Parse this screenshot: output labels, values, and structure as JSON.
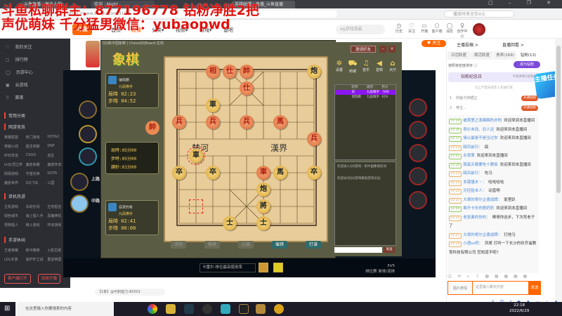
{
  "overlay": {
    "line1": "斗鱼私聊群主：877196778  钻粉净胜2把",
    "line2": "声优萌妹 千分猛男微信：yubaopwd"
  },
  "browser": {
    "tabs": [
      "斗鱼直播 - 每个人的直播平台",
      "欢迎 · Night",
      "英雄联盟 - 直播_斗鱼直播"
    ],
    "url": "https://www.douyu.com/317",
    "search_placeholder": "播放时来全仅4元",
    "window_controls": "□ – ❐ ✕"
  },
  "site": {
    "logo": "斗鱼",
    "nav": [
      "首页",
      "直播",
      "分类▾",
      "视频▾",
      "游戏▾",
      "鱼吧"
    ],
    "search_placeholder": "ag游戏我最",
    "header_icons": [
      {
        "icon": "history-icon",
        "label": "历史",
        "glyph": "◷"
      },
      {
        "icon": "heart-icon",
        "label": "关注",
        "glyph": "♡"
      },
      {
        "icon": "broadcast-icon",
        "label": "开播",
        "glyph": "▭"
      },
      {
        "icon": "client-icon",
        "label": "客户端",
        "glyph": "⬡"
      },
      {
        "icon": "message-icon",
        "label": "消息",
        "glyph": "◯"
      },
      {
        "icon": "creator-icon",
        "label": "创作中心",
        "glyph": "♀"
      }
    ],
    "follow": "♥ 关注"
  },
  "sidebar": {
    "items": [
      {
        "icon": "♡",
        "label": "我的关注"
      },
      {
        "icon": "▢",
        "label": "排行榜"
      },
      {
        "icon": "◯",
        "label": "页游中心"
      },
      {
        "icon": "▣",
        "label": "云游戏"
      },
      {
        "icon": "♖",
        "label": "赛事"
      }
    ],
    "sections": [
      {
        "title": "常用分类",
        "items": []
      },
      {
        "title": "网游竞技",
        "items": [
          "英雄联盟",
          "热门游戏",
          "DOTA2",
          "穿越火线",
          "超击突破",
          "DNF",
          "炉石传说",
          "CSGO",
          "逃生",
          "lol云顶之弈",
          "魔兽争霸",
          "魔兽怀旧",
          "网易游戏",
          "守望先锋",
          "DOTA",
          "魔兽世界",
          "QQ飞车",
          "三国"
        ]
      },
      {
        "title": "单机热游",
        "items": [
          "主机游戏",
          "永劫无间",
          "生死狙击",
          "绿色城市",
          "海上猎人手",
          "恶魔神机",
          "怪物猎人",
          "格斗游戏",
          "怀旧游戏"
        ]
      },
      {
        "title": "手游休闲",
        "items": [
          "王者荣耀",
          "和平精英",
          "火影忍者",
          "LOL手游",
          "金铲铲之战",
          "重返帝国"
        ]
      }
    ],
    "buttons": [
      "客户端打开",
      "回放开播"
    ]
  },
  "lol": {
    "lanes": [
      "上路",
      "中路"
    ],
    "champ_select": "卡雷尔-排位最高使用率",
    "mode_top": "5V5",
    "mode": "排位赛 单排/双排"
  },
  "chess": {
    "title": "QQ新中国象棋 | ChessQQBoard 在线",
    "logo": "象棋",
    "player_top": {
      "name": "瑞狗鹏",
      "rank": "九段棋手",
      "game_time_label": "局時",
      "game_time": "02:23",
      "step_time_label": "步時",
      "step_time": "04:52"
    },
    "settings": [
      {
        "label": "局時:",
        "value": "05分00"
      },
      {
        "label": "步時:",
        "value": "05分00"
      },
      {
        "label": "讀秒:",
        "value": "01分00"
      }
    ],
    "player_bottom": {
      "name": "自家的象",
      "rank": "九段棋手",
      "game_time_label": "局時",
      "game_time": "02:41",
      "step_time_label": "步時",
      "step_time": "00:00"
    },
    "river_left": "楚河",
    "river_right": "漢界",
    "captured": "帥",
    "pieces": [
      {
        "c": "相",
        "side": "red",
        "col": 2,
        "row": 0
      },
      {
        "c": "仕",
        "side": "red",
        "col": 3,
        "row": 0
      },
      {
        "c": "帥",
        "side": "red",
        "col": 4,
        "row": 0
      },
      {
        "c": "仕",
        "side": "red",
        "col": 4,
        "row": 1
      },
      {
        "c": "兵",
        "side": "red",
        "col": 0,
        "row": 3
      },
      {
        "c": "兵",
        "side": "red",
        "col": 2,
        "row": 3
      },
      {
        "c": "兵",
        "side": "red",
        "col": 4,
        "row": 3
      },
      {
        "c": "馬",
        "side": "red",
        "col": 6,
        "row": 3
      },
      {
        "c": "兵",
        "side": "red",
        "col": 8,
        "row": 4
      },
      {
        "c": "車",
        "side": "red",
        "col": 5,
        "row": 6
      },
      {
        "c": "炮",
        "side": "black",
        "col": 8,
        "row": 0
      },
      {
        "c": "車",
        "side": "black",
        "col": 2,
        "row": 2
      },
      {
        "c": "車",
        "side": "black",
        "col": 1,
        "row": 5,
        "selected": true
      },
      {
        "c": "卒",
        "side": "black",
        "col": 0,
        "row": 6
      },
      {
        "c": "卒",
        "side": "black",
        "col": 2,
        "row": 6
      },
      {
        "c": "馬",
        "side": "black",
        "col": 6,
        "row": 6
      },
      {
        "c": "卒",
        "side": "black",
        "col": 8,
        "row": 6
      },
      {
        "c": "炮",
        "side": "black",
        "col": 5,
        "row": 7
      },
      {
        "c": "將",
        "side": "black",
        "col": 5,
        "row": 8
      },
      {
        "c": "士",
        "side": "black",
        "col": 3,
        "row": 9
      },
      {
        "c": "士",
        "side": "black",
        "col": 5,
        "row": 9
      }
    ],
    "last_move_from": {
      "col": 1,
      "row": 8
    },
    "buttons": [
      {
        "label": "求和",
        "enabled": false
      },
      {
        "label": "悔棋",
        "enabled": false
      },
      {
        "label": "认输",
        "enabled": false
      },
      {
        "label": "催棋",
        "enabled": true
      },
      {
        "label": "打谱",
        "enabled": true
      }
    ],
    "invite": "邀请好友",
    "tools": [
      {
        "icon": "gear-icon",
        "glyph": "✲",
        "label": "设置"
      },
      {
        "icon": "cart-icon",
        "glyph": "⛟",
        "label": "商城"
      },
      {
        "icon": "music-icon",
        "glyph": "♫",
        "label": "音乐"
      },
      {
        "icon": "speaker-icon",
        "glyph": "◀",
        "label": "音效"
      },
      {
        "icon": "home-icon",
        "glyph": "⌂",
        "label": "大厅"
      }
    ],
    "table_headers": [
      "昵称",
      "级别",
      "积分"
    ],
    "table_rows": [
      {
        "name": "白",
        "rank": "九段棋手",
        "score": "-500",
        "selected": true
      },
      {
        "name": "瑞狗鹏",
        "rank": "九段棋手",
        "score": "619"
      }
    ],
    "messages": [
      "欢迎进入QQ游戏 - 新中国象棋房间",
      "欢迎访问QQ游戏棋类游戏论坛:"
    ],
    "send": "发送"
  },
  "stream": {
    "notice": "【1条】@可积能力-8X501"
  },
  "right": {
    "host_posts": "主播投稿 >",
    "replay": "直播回看 >",
    "tabs": [
      "日活跃度",
      "周活跃度",
      "贵宾(169)",
      "钻粉(13)"
    ],
    "sort_label": "按照亲密度排序 ⓘ",
    "become_fan": "成为钻粉",
    "memorial": "钻粉纪念日",
    "memorial_note": "今日共有1位钻粉",
    "memorial_sub": "马上严禁未成年人充值打赏",
    "ranks": [
      {
        "n": "1",
        "name": "阿鱼与你晒辽"
      },
      {
        "n": "2",
        "name": "咻五..."
      }
    ],
    "rank_badge": "开通钻粉",
    "task_badge": "主播任务",
    "chat": [
      {
        "lv": "LV 39",
        "user": "被窝里之清离瞬的亦昀",
        "text": "欢迎来到本直播间"
      },
      {
        "lv": "LV 36",
        "user": "青衫未改、旧人还",
        "text": "欢迎来到本直播间"
      },
      {
        "lv": "LV 37",
        "user": "倘以最是不是当过你",
        "text": "欢迎来到本直播间"
      },
      {
        "lv": "LV 13",
        "user": "瓯风前行：",
        "text": "搞",
        "low": true
      },
      {
        "lv": "LV 41",
        "user": "永夜翠",
        "text": "欢迎来到本直播间"
      },
      {
        "lv": "LV 39",
        "user": "我每天都要吃十颗饭",
        "text": "欢迎来到本直播间"
      },
      {
        "lv": "LV 13",
        "user": "瓯风前行：",
        "text": "吃马",
        "low": true
      },
      {
        "lv": "LV 15",
        "user": "多需懂木丶：",
        "text": "哈哈哈哈",
        "low": true
      },
      {
        "lv": "LV 13",
        "user": "兄控狙本人：",
        "text": "动直啊",
        "low": true
      },
      {
        "lv": "LV 27",
        "user": "大哥的哥尔企德战牌：",
        "text": "家里趴",
        "low": true
      },
      {
        "lv": "LV 49",
        "user": "凿开卡车的傻奶奶",
        "text": "欢迎来到本直播间"
      },
      {
        "lv": "LV 11",
        "user": "老张离的你的：",
        "text": "棒哥你这步，下次死老子了",
        "low": true
      },
      {
        "lv": "LV 27",
        "user": "大哥的哥尔企德战牌：",
        "text": "打他马",
        "low": true
      },
      {
        "lv": "LV 14",
        "user": "小酒ss吧：",
        "text": "风哥 打听一下长沙的玖齐遥教育科技有限公司 您知道不呢?",
        "low": true
      }
    ],
    "toolbar": "☺ ✉ ➶ ♖ ▦ ▦ ▦ ▦ ▦",
    "input_placeholder": "这里输入聊天内容",
    "pic_label": "图片表情",
    "send": "发送"
  },
  "taskbar": {
    "search": "在这里输入你要搜索的内容",
    "time": "22:18",
    "date": "2022/6/29",
    "ime": "S 中 ⁴ ● ♦ ▭ ⊥ ♞ ⊞"
  }
}
